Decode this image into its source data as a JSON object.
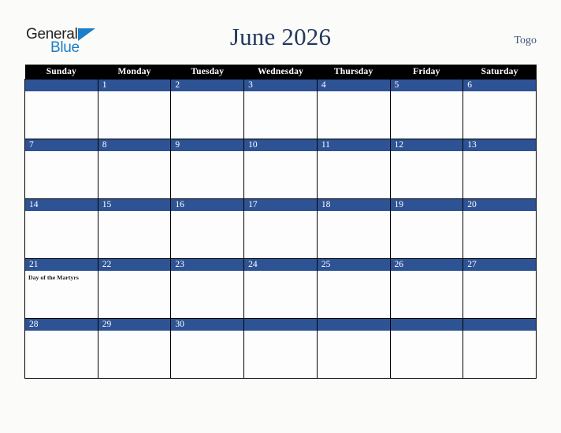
{
  "brand": {
    "name_part1": "General",
    "name_part2": "Blue",
    "triangle_color": "#1b7ec6",
    "text_color": "#231f20"
  },
  "header": {
    "title": "June 2026",
    "country": "Togo",
    "title_color": "#23395d"
  },
  "calendar": {
    "weekday_headers": [
      "Sunday",
      "Monday",
      "Tuesday",
      "Wednesday",
      "Thursday",
      "Friday",
      "Saturday"
    ],
    "header_bg": "#000000",
    "daybar_bg": "#2e5395",
    "weeks": [
      [
        {
          "day": "",
          "event": ""
        },
        {
          "day": "1",
          "event": ""
        },
        {
          "day": "2",
          "event": ""
        },
        {
          "day": "3",
          "event": ""
        },
        {
          "day": "4",
          "event": ""
        },
        {
          "day": "5",
          "event": ""
        },
        {
          "day": "6",
          "event": ""
        }
      ],
      [
        {
          "day": "7",
          "event": ""
        },
        {
          "day": "8",
          "event": ""
        },
        {
          "day": "9",
          "event": ""
        },
        {
          "day": "10",
          "event": ""
        },
        {
          "day": "11",
          "event": ""
        },
        {
          "day": "12",
          "event": ""
        },
        {
          "day": "13",
          "event": ""
        }
      ],
      [
        {
          "day": "14",
          "event": ""
        },
        {
          "day": "15",
          "event": ""
        },
        {
          "day": "16",
          "event": ""
        },
        {
          "day": "17",
          "event": ""
        },
        {
          "day": "18",
          "event": ""
        },
        {
          "day": "19",
          "event": ""
        },
        {
          "day": "20",
          "event": ""
        }
      ],
      [
        {
          "day": "21",
          "event": "Day of the Martyrs"
        },
        {
          "day": "22",
          "event": ""
        },
        {
          "day": "23",
          "event": ""
        },
        {
          "day": "24",
          "event": ""
        },
        {
          "day": "25",
          "event": ""
        },
        {
          "day": "26",
          "event": ""
        },
        {
          "day": "27",
          "event": ""
        }
      ],
      [
        {
          "day": "28",
          "event": ""
        },
        {
          "day": "29",
          "event": ""
        },
        {
          "day": "30",
          "event": ""
        },
        {
          "day": "",
          "event": ""
        },
        {
          "day": "",
          "event": ""
        },
        {
          "day": "",
          "event": ""
        },
        {
          "day": "",
          "event": ""
        }
      ]
    ]
  }
}
